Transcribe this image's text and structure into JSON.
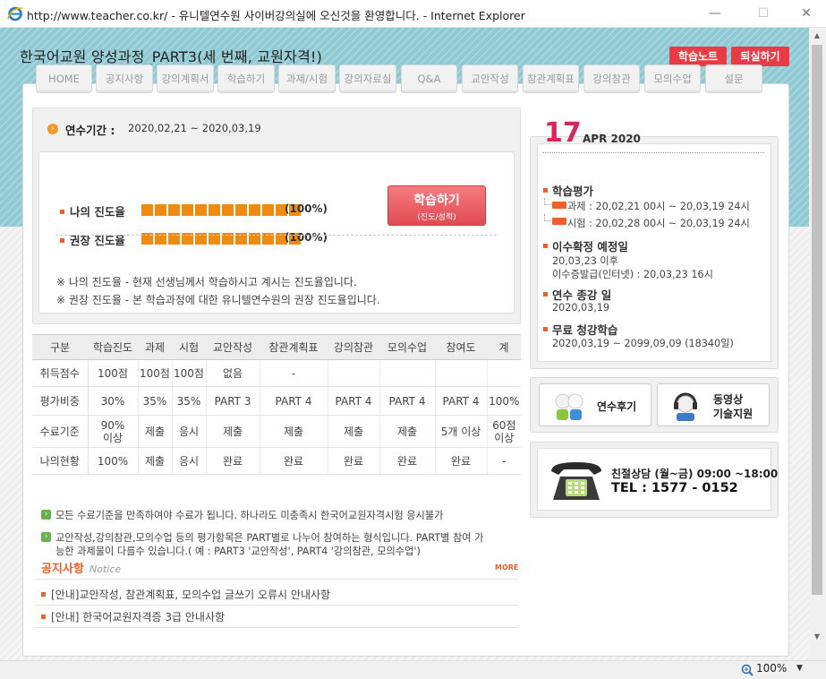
{
  "window": {
    "title": "http://www.teacher.co.kr/ - 유니텔연수원 사이버강의실에 오신것을 환영합니다. - Internet Explorer",
    "minimize": "—",
    "maximize": "☐",
    "close": "✕"
  },
  "header": {
    "course_title": "한국어교원 양성과정_PART3(세 번째, 교원자격!)",
    "study_note": "학습노트",
    "exit": "퇴실하기"
  },
  "nav": [
    "HOME",
    "공지사항",
    "강의계획서",
    "학습하기",
    "과제/시험",
    "강의자료실",
    "Q&A",
    "교안작성",
    "참관계획표",
    "강의참관",
    "모의수업",
    "설문"
  ],
  "period": {
    "label": "연수기간 :",
    "value": "2020,02,21 ~ 2020,03,19"
  },
  "progress": {
    "my_label": "나의 진도율",
    "my_pct": "(100%)",
    "my_value": 1.0,
    "rec_label": "권장 진도율",
    "rec_pct": "(100%)",
    "rec_value": 1.0,
    "study_button": "학습하기",
    "study_button_sub": "(진도/성적)",
    "note1": "※ 나의 진도율 - 현재 선생님께서 학습하시고 계시는 진도율입니다.",
    "note2": "※ 권장 진도율 - 본 학습과정에 대한 유니텔연수원의 권장 진도율입니다."
  },
  "grade_table": {
    "headers": [
      "구분",
      "학습진도",
      "과제",
      "시험",
      "교안작성",
      "참관계획표",
      "강의참관",
      "모의수업",
      "참여도",
      "계"
    ],
    "rows": [
      {
        "label": "취득점수",
        "cells": [
          "100점",
          "100점",
          "100점",
          "없음",
          "-",
          "",
          "",
          "",
          ""
        ]
      },
      {
        "label": "평가비중",
        "cells": [
          "30%",
          "35%",
          "35%",
          "PART 3",
          "PART 4",
          "PART 4",
          "PART 4",
          "PART 4",
          "100%"
        ]
      },
      {
        "label": "수료기준",
        "cells": [
          "90%\n이상",
          "제출",
          "응시",
          "제출",
          "제출",
          "제출",
          "제출",
          "5개 이상",
          "60점\n이상"
        ]
      },
      {
        "label": "나의현황",
        "cells": [
          "100%",
          "제출",
          "응시",
          "완료",
          "완료",
          "완료",
          "완료",
          "완료",
          "-"
        ]
      }
    ]
  },
  "info": {
    "line1": "모든 수료기준을 만족하여야 수료가 됩니다. 하나라도 미충족시 한국어교원자격시험 응시불가",
    "line2a": "교안작성,강의참관,모의수업 등의 평가항목은 PART별로 나누어 참여하는 형식입니다. PART별 참여 가",
    "line2b": "능한 과제물이 다를수 있습니다.( 예 : PART3 '교안작성', PART4 '강의참관, 모의수업')"
  },
  "notice": {
    "title": "공지사항",
    "subtitle": "Notice",
    "more": "MORE",
    "items": [
      "[안내]교안작성, 참관계획표, 모의수업 글쓰기 오류시 안내사항",
      "[안내] 한국어교원자격증 3급 안내사항"
    ]
  },
  "calendar": {
    "day": "17",
    "month_year": "APR 2020",
    "eval_title": "학습평가",
    "tag": "ON",
    "assignment": "과제 : 20,02,21 00시 ~ 20,03,19 24시",
    "exam": "시험 : 20,02,28 00시 ~ 20,03,19 24시",
    "completion_title": "이수확정 예정일",
    "completion_line1": "20,03,23 이후",
    "completion_line2": "이수증발급(인터넷) : 20,03,23 16시",
    "end_title": "연수 종강 일",
    "end_value": "2020,03,19",
    "free_title": "무료 청강학습",
    "free_value": "2020,03,19 ~ 2099,09,09 (18340일)"
  },
  "links": {
    "review": "연수후기",
    "support_line1": "동영상",
    "support_line2": "기술지원"
  },
  "consult": {
    "title": "친절상담 (월~금) 09:00 ~18:00",
    "tel": "TEL : 1577 - 0152"
  },
  "status": {
    "zoom": "100%",
    "zoom_arrow": "▼"
  },
  "colors": {
    "accent_red": "#ea3a45",
    "progress_orange": "#ee8b10",
    "header_teal": "#8fc9d3",
    "date_pink": "#d6285a"
  }
}
